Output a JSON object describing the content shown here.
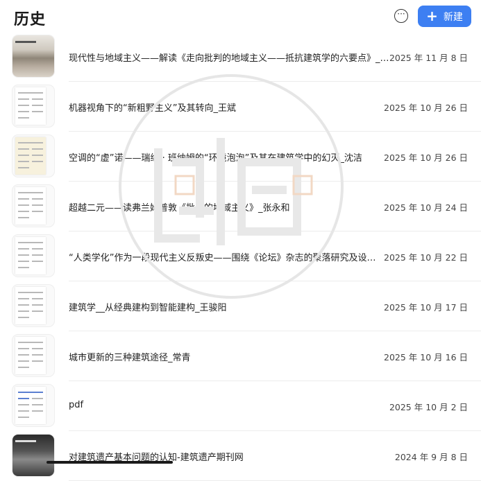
{
  "header": {
    "title": "历史",
    "more_label": "···",
    "new_label": "新建",
    "accent": "#3d7ff2"
  },
  "items": [
    {
      "title": "现代性与地域主义——解读《走向批判的地域主义——抵抗建筑学的六要点》_…",
      "date": "2025 年 11 月 8 日",
      "thumb": "photo"
    },
    {
      "title": "机器视角下的“新粗野主义”及其转向_王斌",
      "date": "2025 年 10 月 26 日",
      "thumb": "doc"
    },
    {
      "title": "空调的“虚”诺——瑞纳 · 班纳姆的“环境泡泡”及其在建筑学中的幻灭_沈洁",
      "date": "2025 年 10 月 26 日",
      "thumb": "doc-yellow"
    },
    {
      "title": "超越二元——读弗兰姆普敦《批判的地域主义》_张永和",
      "date": "2025 年 10 月 24 日",
      "thumb": "doc"
    },
    {
      "title": "“人类学化”作为一段现代主义反叛史——围绕《论坛》杂志的聚落研究及设…",
      "date": "2025 年 10 月 22 日",
      "thumb": "doc"
    },
    {
      "title": "建筑学__从经典建构到智能建构_王骏阳",
      "date": "2025 年 10 月 17 日",
      "thumb": "doc"
    },
    {
      "title": "城市更新的三种建筑途径_常青",
      "date": "2025 年 10 月 16 日",
      "thumb": "doc"
    },
    {
      "title": "pdf",
      "date": "2025 年 10 月 2 日",
      "thumb": "doc-blue"
    },
    {
      "title": "对建筑遗产基本问题的认知-建筑遗产期刊网",
      "date": "2024 年 9 月 8 日",
      "thumb": "photo-dark"
    }
  ]
}
